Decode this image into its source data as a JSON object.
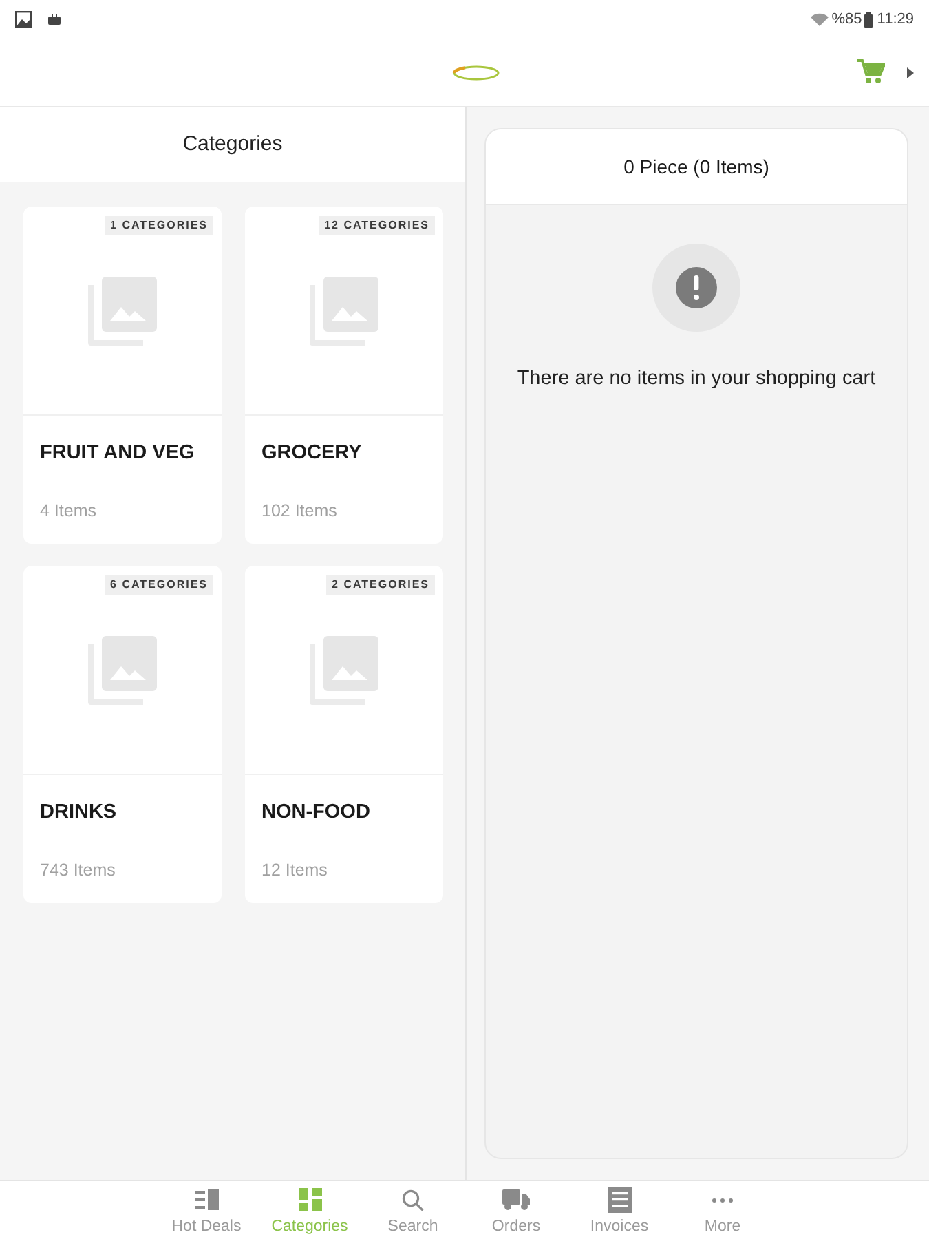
{
  "status_bar": {
    "battery": "%85",
    "time": "11:29"
  },
  "categories_panel": {
    "title": "Categories",
    "cards": [
      {
        "badge": "1 CATEGORIES",
        "name": "FRUIT AND VEG",
        "count": "4 Items"
      },
      {
        "badge": "12 CATEGORIES",
        "name": "GROCERY",
        "count": "102 Items"
      },
      {
        "badge": "6 CATEGORIES",
        "name": "DRINKS",
        "count": "743 Items"
      },
      {
        "badge": "2 CATEGORIES",
        "name": "NON-FOOD",
        "count": "12 Items"
      }
    ]
  },
  "cart": {
    "title": "0 Piece (0 Items)",
    "empty_message": "There are no items in your shopping cart"
  },
  "bottom_nav": [
    {
      "kind": "deals",
      "label": "Hot Deals",
      "selected": false
    },
    {
      "kind": "categories",
      "label": "Categories",
      "selected": true
    },
    {
      "kind": "search",
      "label": "Search",
      "selected": false
    },
    {
      "kind": "orders",
      "label": "Orders",
      "selected": false
    },
    {
      "kind": "invoices",
      "label": "Invoices",
      "selected": false
    },
    {
      "kind": "more",
      "label": "More",
      "selected": false
    }
  ]
}
